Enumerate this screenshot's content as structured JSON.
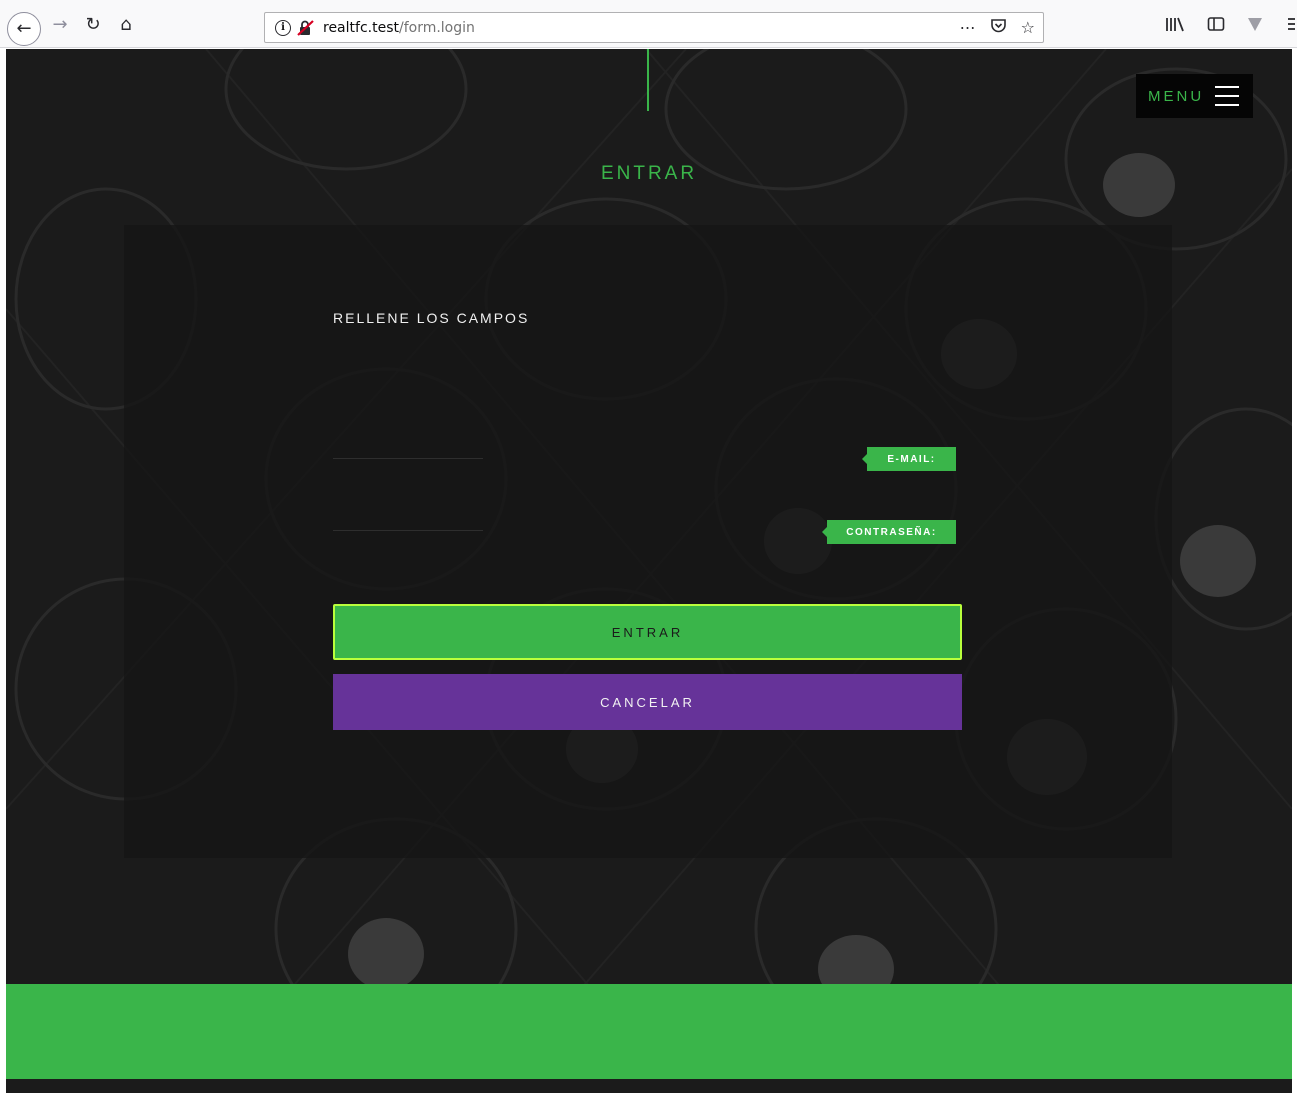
{
  "browser": {
    "url_host": "realtfc.test",
    "url_path": "/form.login",
    "icons": [
      "back-icon",
      "forward-icon",
      "reload-icon",
      "home-icon",
      "info-icon",
      "insecure-lock-icon",
      "page-actions-icon",
      "pocket-icon",
      "bookmark-star-icon",
      "library-icon",
      "sidebar-icon",
      "extension-icon",
      "overflow-menu-icon"
    ]
  },
  "header": {
    "menu_label": "MENU"
  },
  "main": {
    "title": "ENTRAR",
    "form_heading": "RELLENE LOS CAMPOS",
    "fields": {
      "email_label": "E-MAIL:",
      "password_label": "CONTRASEÑA:"
    },
    "buttons": {
      "submit_label": "ENTRAR",
      "cancel_label": "CANCELAR"
    }
  },
  "colors": {
    "accent_green": "#3ab54a",
    "cancel_purple": "#663399",
    "background_dark": "#1b1b1b",
    "highlight_lime": "#b9ff3c"
  }
}
